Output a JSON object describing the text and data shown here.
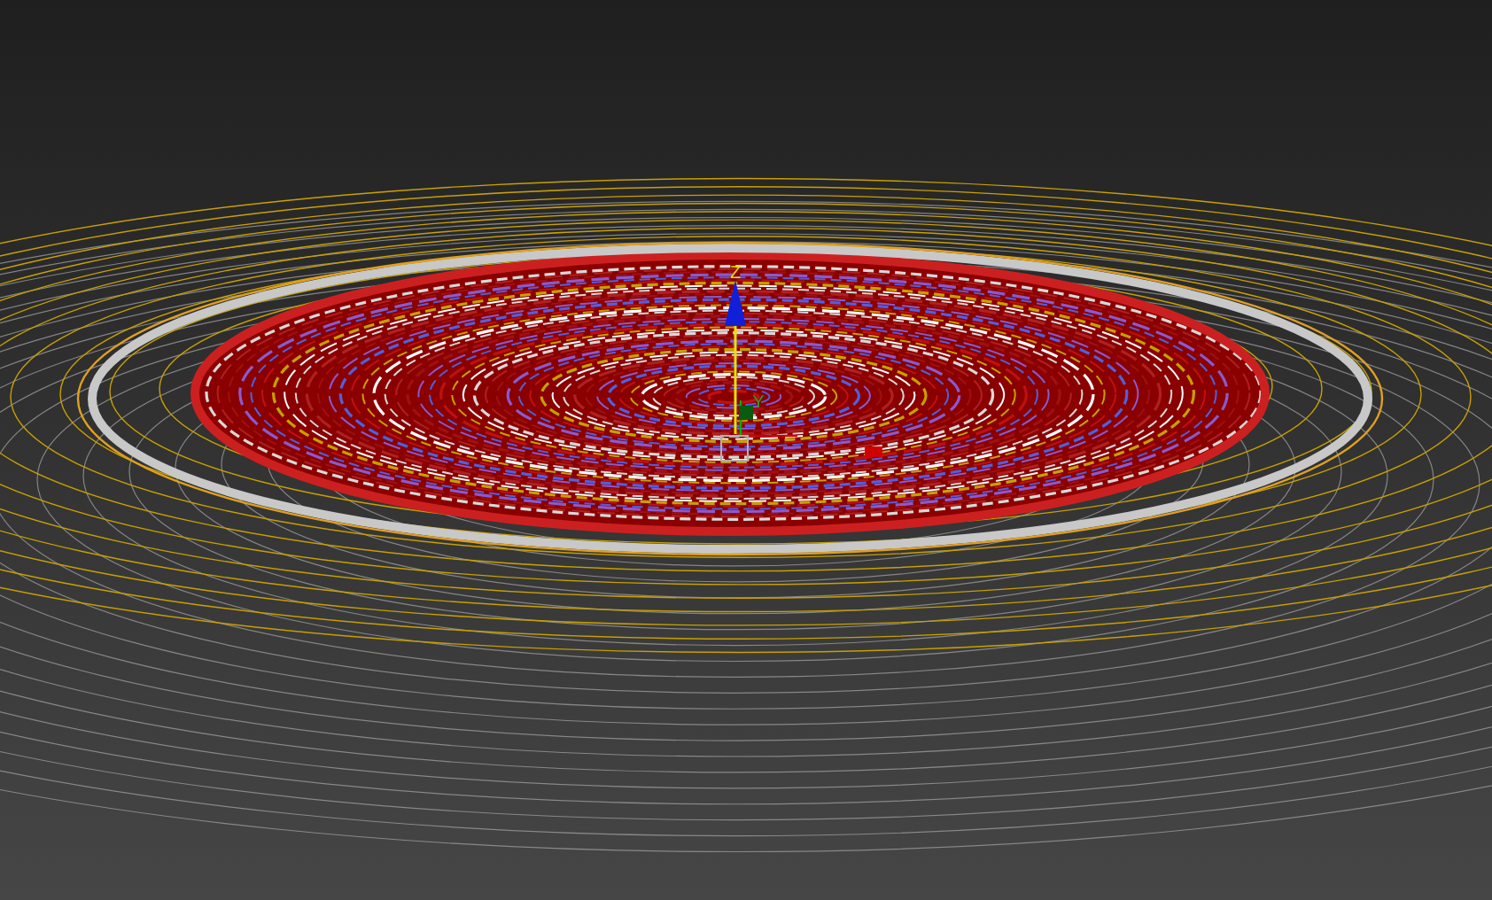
{
  "viewport": {
    "gizmo": {
      "axes": [
        {
          "label": "Z",
          "kind": "z"
        },
        {
          "label": "Y",
          "kind": "y"
        }
      ]
    }
  }
}
